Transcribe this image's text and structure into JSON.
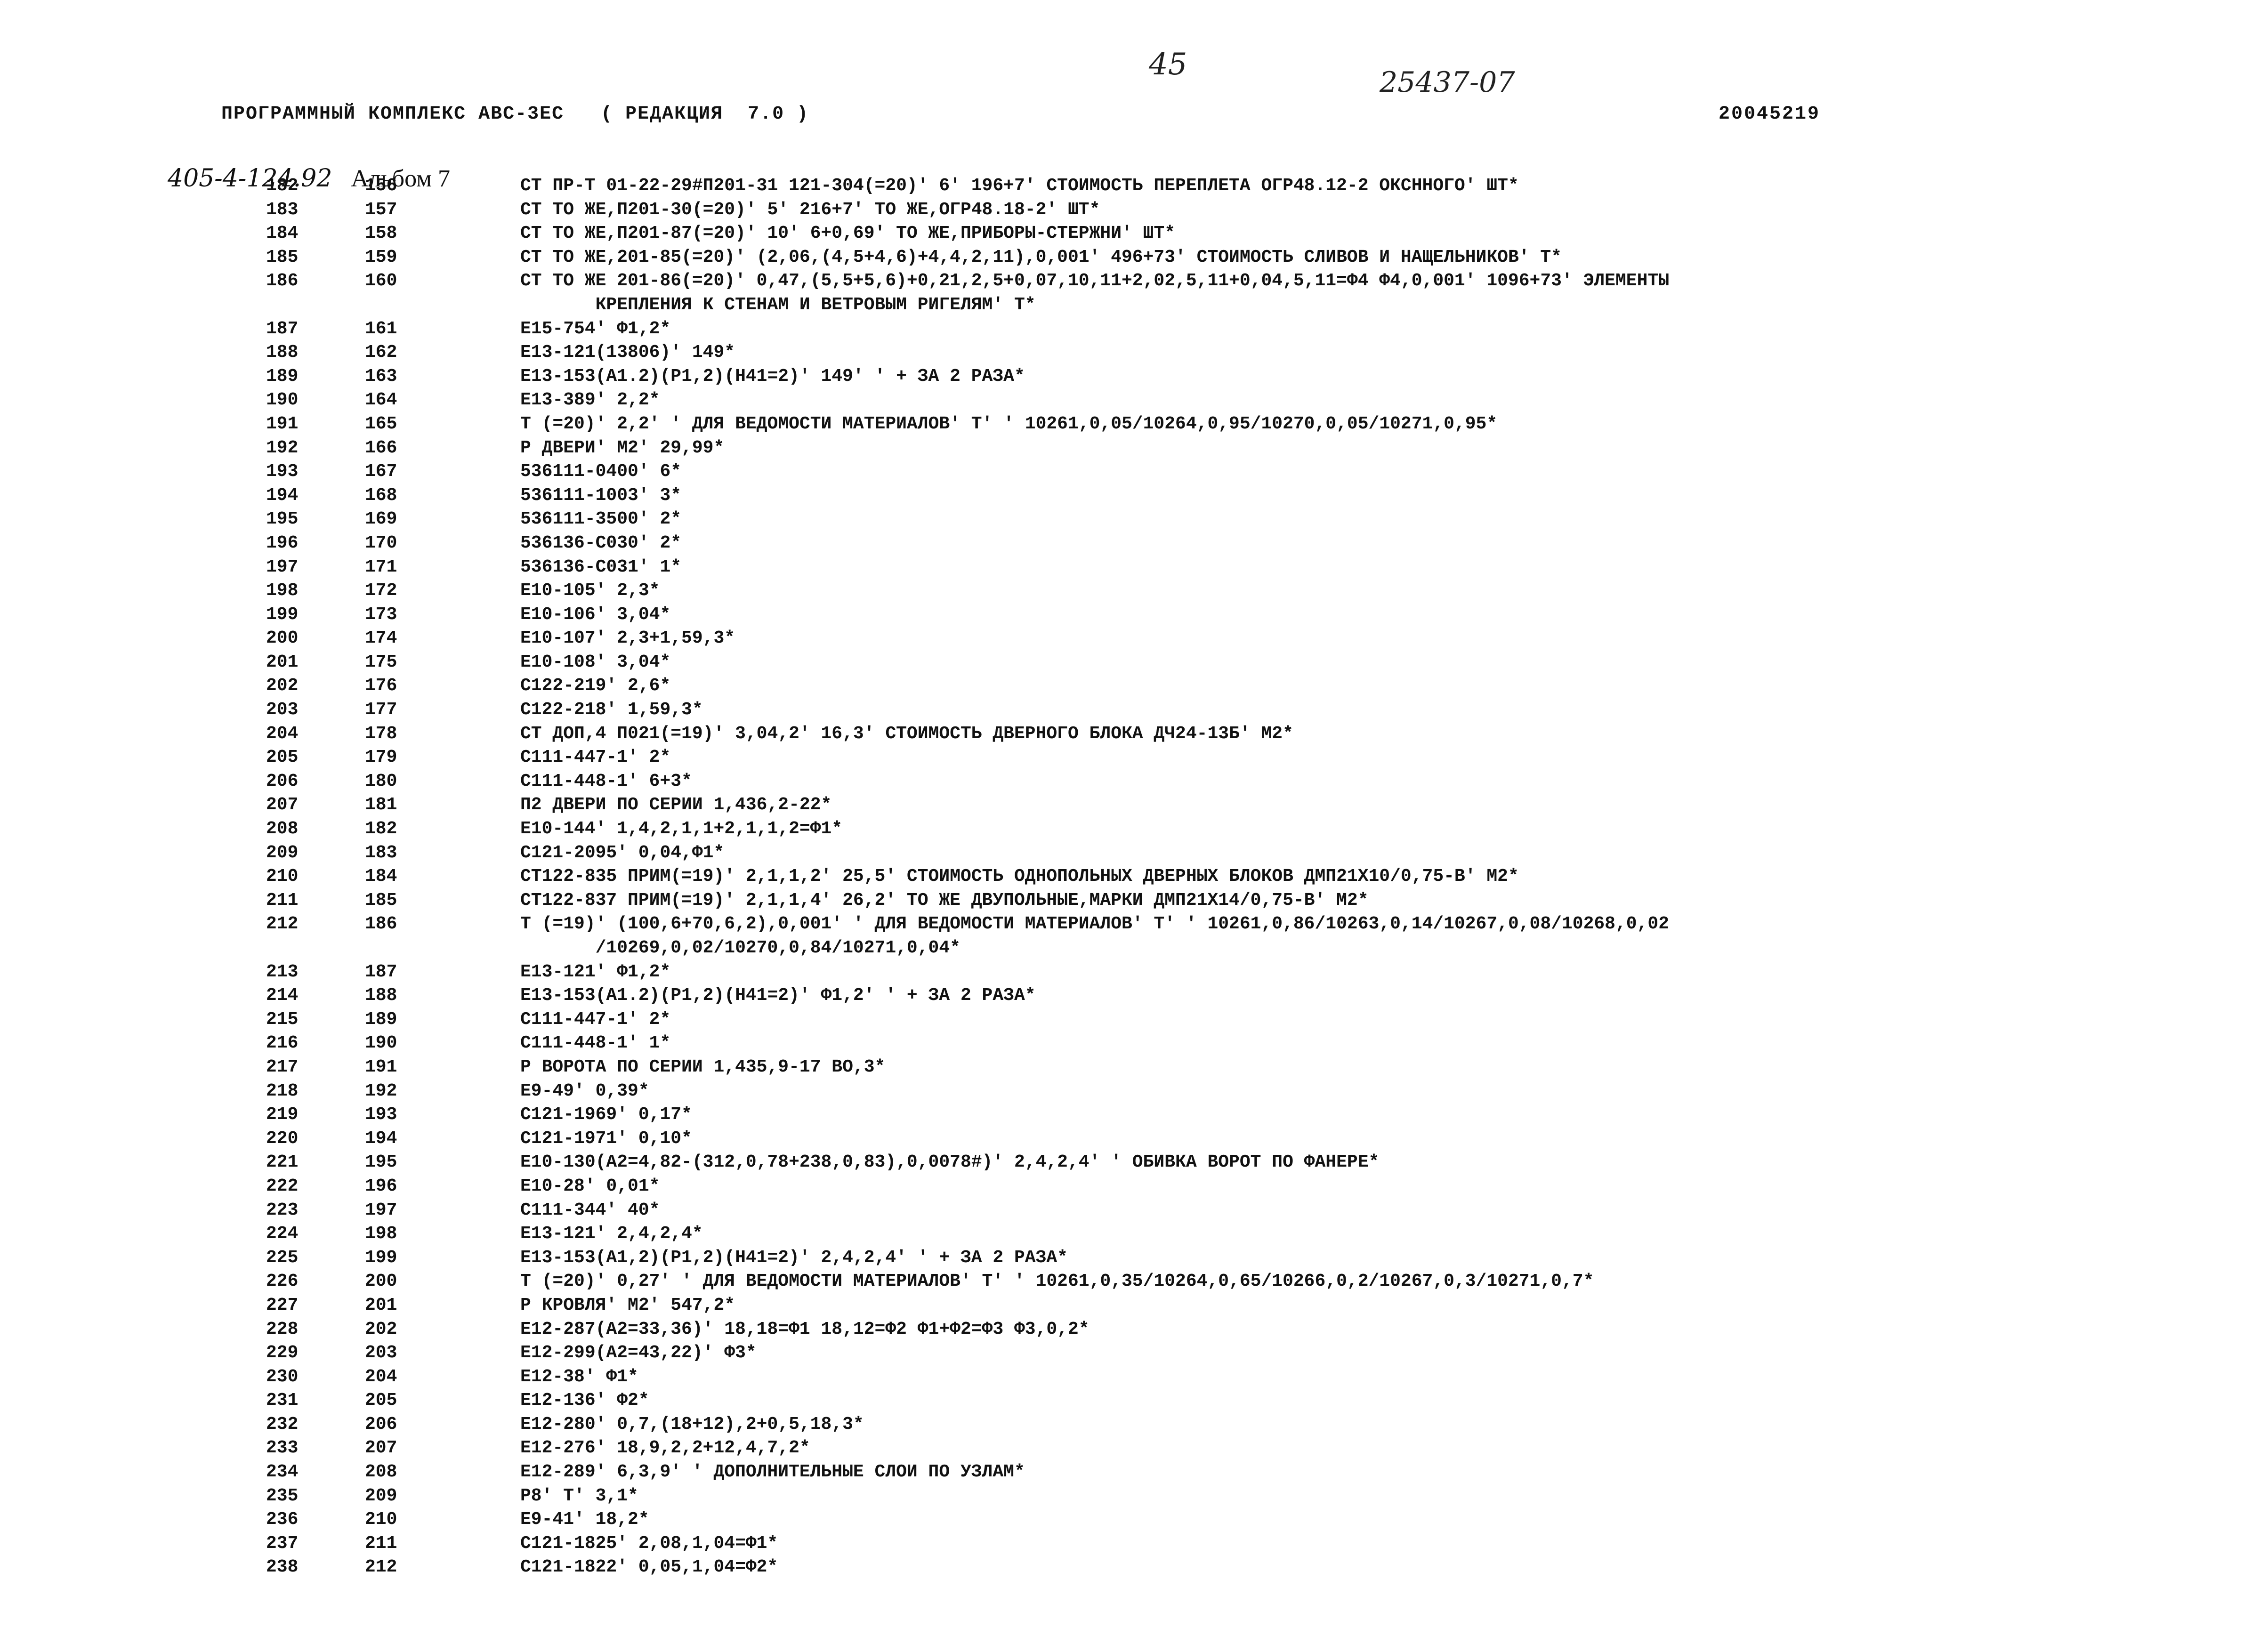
{
  "page_number": "45",
  "document_code": "25437-07",
  "header": {
    "title": "ПРОГРАММНЫЙ КОМПЛЕКС АВС-3ЕС   ( РЕДАКЦИЯ  7.0 )",
    "id": "20045219"
  },
  "album": {
    "code": "405-4-124.92",
    "label": "Альбом 7"
  },
  "rows": [
    {
      "n1": "182",
      "n2": "156",
      "text": "СТ ПР-Т 01-22-29#П201-31 121-304(=20)' 6' 196+7' СТОИМОСТЬ ПЕРЕПЛЕТА ОГР48.12-2 ОКСННОГО' ШТ*"
    },
    {
      "n1": "183",
      "n2": "157",
      "text": "СТ ТО ЖЕ,П201-30(=20)' 5' 216+7' ТО ЖЕ,ОГР48.18-2' ШТ*"
    },
    {
      "n1": "184",
      "n2": "158",
      "text": "СТ ТО ЖЕ,П201-87(=20)' 10' 6+0,69' ТО ЖЕ,ПРИБОРЫ-СТЕРЖНИ' ШТ*"
    },
    {
      "n1": "185",
      "n2": "159",
      "text": "СТ ТО ЖЕ,201-85(=20)' (2,06,(4,5+4,6)+4,4,2,11),0,001' 496+73' СТОИМОСТЬ СЛИВОВ И НАЩЕЛЬНИКОВ' Т*"
    },
    {
      "n1": "186",
      "n2": "160",
      "text": "СТ ТО ЖЕ 201-86(=20)' 0,47,(5,5+5,6)+0,21,2,5+0,07,10,11+2,02,5,11+0,04,5,11=Ф4 Ф4,0,001' 1096+73' ЭЛЕМЕНТЫ"
    },
    {
      "n1": "",
      "n2": "",
      "text": "       КРЕПЛЕНИЯ К СТЕНАМ И ВЕТРОВЫМ РИГЕЛЯМ' Т*",
      "cont": true
    },
    {
      "n1": "187",
      "n2": "161",
      "text": "Е15-754' Ф1,2*"
    },
    {
      "n1": "188",
      "n2": "162",
      "text": "Е13-121(13806)' 149*"
    },
    {
      "n1": "189",
      "n2": "163",
      "text": "Е13-153(А1.2)(Р1,2)(Н41=2)' 149' ' + ЗА 2 РАЗА*"
    },
    {
      "n1": "190",
      "n2": "164",
      "text": "Е13-389' 2,2*"
    },
    {
      "n1": "191",
      "n2": "165",
      "text": "Т (=20)' 2,2' ' ДЛЯ ВЕДОМОСТИ МАТЕРИАЛОВ' Т' ' 10261,0,05/10264,0,95/10270,0,05/10271,0,95*"
    },
    {
      "n1": "192",
      "n2": "166",
      "text": "Р ДВЕРИ' М2' 29,99*"
    },
    {
      "n1": "193",
      "n2": "167",
      "text": "536111-0400' 6*"
    },
    {
      "n1": "194",
      "n2": "168",
      "text": "536111-1003' 3*"
    },
    {
      "n1": "195",
      "n2": "169",
      "text": "536111-3500' 2*"
    },
    {
      "n1": "196",
      "n2": "170",
      "text": "536136-С030' 2*"
    },
    {
      "n1": "197",
      "n2": "171",
      "text": "536136-С031' 1*"
    },
    {
      "n1": "198",
      "n2": "172",
      "text": "Е10-105' 2,3*"
    },
    {
      "n1": "199",
      "n2": "173",
      "text": "Е10-106' 3,04*"
    },
    {
      "n1": "200",
      "n2": "174",
      "text": "Е10-107' 2,3+1,59,3*"
    },
    {
      "n1": "201",
      "n2": "175",
      "text": "Е10-108' 3,04*"
    },
    {
      "n1": "202",
      "n2": "176",
      "text": "С122-219' 2,6*"
    },
    {
      "n1": "203",
      "n2": "177",
      "text": "С122-218' 1,59,3*"
    },
    {
      "n1": "204",
      "n2": "178",
      "text": "СТ ДОП,4 П021(=19)' 3,04,2' 16,3' СТОИМОСТЬ ДВЕРНОГО БЛОКА ДЧ24-13Б' М2*"
    },
    {
      "n1": "205",
      "n2": "179",
      "text": "С111-447-1' 2*"
    },
    {
      "n1": "206",
      "n2": "180",
      "text": "С111-448-1' 6+3*"
    },
    {
      "n1": "207",
      "n2": "181",
      "text": "П2 ДВЕРИ ПО СЕРИИ 1,436,2-22*"
    },
    {
      "n1": "208",
      "n2": "182",
      "text": "Е10-144' 1,4,2,1,1+2,1,1,2=Ф1*"
    },
    {
      "n1": "209",
      "n2": "183",
      "text": "С121-2095' 0,04,Ф1*"
    },
    {
      "n1": "210",
      "n2": "184",
      "text": "СТ122-835 ПРИМ(=19)' 2,1,1,2' 25,5' СТОИМОСТЬ ОДНОПОЛЬНЫХ ДВЕРНЫХ БЛОКОВ ДМП21Х10/0,75-В' М2*"
    },
    {
      "n1": "211",
      "n2": "185",
      "text": "СТ122-837 ПРИМ(=19)' 2,1,1,4' 26,2' ТО ЖЕ ДВУПОЛЬНЫЕ,МАРКИ ДМП21Х14/0,75-В' М2*"
    },
    {
      "n1": "212",
      "n2": "186",
      "text": "Т (=19)' (100,6+70,6,2),0,001' ' ДЛЯ ВЕДОМОСТИ МАТЕРИАЛОВ' Т' ' 10261,0,86/10263,0,14/10267,0,08/10268,0,02"
    },
    {
      "n1": "",
      "n2": "",
      "text": "       /10269,0,02/10270,0,84/10271,0,04*",
      "cont": true
    },
    {
      "n1": "213",
      "n2": "187",
      "text": "Е13-121' Ф1,2*"
    },
    {
      "n1": "214",
      "n2": "188",
      "text": "Е13-153(А1.2)(Р1,2)(Н41=2)' Ф1,2' ' + ЗА 2 РАЗА*"
    },
    {
      "n1": "215",
      "n2": "189",
      "text": "С111-447-1' 2*"
    },
    {
      "n1": "216",
      "n2": "190",
      "text": "С111-448-1' 1*"
    },
    {
      "n1": "217",
      "n2": "191",
      "text": "Р ВОРОТА ПО СЕРИИ 1,435,9-17 ВО,3*"
    },
    {
      "n1": "218",
      "n2": "192",
      "text": "Е9-49' 0,39*"
    },
    {
      "n1": "219",
      "n2": "193",
      "text": "С121-1969' 0,17*"
    },
    {
      "n1": "220",
      "n2": "194",
      "text": "С121-1971' 0,10*"
    },
    {
      "n1": "221",
      "n2": "195",
      "text": "Е10-130(А2=4,82-(312,0,78+238,0,83),0,0078#)' 2,4,2,4' ' ОБИВКА ВОРОТ ПО ФАНЕРЕ*"
    },
    {
      "n1": "222",
      "n2": "196",
      "text": "Е10-28' 0,01*"
    },
    {
      "n1": "223",
      "n2": "197",
      "text": "С111-344' 40*"
    },
    {
      "n1": "224",
      "n2": "198",
      "text": "Е13-121' 2,4,2,4*"
    },
    {
      "n1": "225",
      "n2": "199",
      "text": "Е13-153(А1,2)(Р1,2)(Н41=2)' 2,4,2,4' ' + ЗА 2 РАЗА*"
    },
    {
      "n1": "226",
      "n2": "200",
      "text": "Т (=20)' 0,27' ' ДЛЯ ВЕДОМОСТИ МАТЕРИАЛОВ' Т' ' 10261,0,35/10264,0,65/10266,0,2/10267,0,3/10271,0,7*"
    },
    {
      "n1": "227",
      "n2": "201",
      "text": "Р КРОВЛЯ' М2' 547,2*"
    },
    {
      "n1": "228",
      "n2": "202",
      "text": "Е12-287(А2=33,36)' 18,18=Ф1 18,12=Ф2 Ф1+Ф2=Ф3 Ф3,0,2*"
    },
    {
      "n1": "229",
      "n2": "203",
      "text": "Е12-299(А2=43,22)' Ф3*"
    },
    {
      "n1": "230",
      "n2": "204",
      "text": "Е12-38' Ф1*"
    },
    {
      "n1": "231",
      "n2": "205",
      "text": "Е12-136' Ф2*"
    },
    {
      "n1": "232",
      "n2": "206",
      "text": "Е12-280' 0,7,(18+12),2+0,5,18,3*"
    },
    {
      "n1": "233",
      "n2": "207",
      "text": "Е12-276' 18,9,2,2+12,4,7,2*"
    },
    {
      "n1": "234",
      "n2": "208",
      "text": "Е12-289' 6,3,9' ' ДОПОЛНИТЕЛЬНЫЕ СЛОИ ПО УЗЛАМ*"
    },
    {
      "n1": "235",
      "n2": "209",
      "text": "Р8' Т' 3,1*"
    },
    {
      "n1": "236",
      "n2": "210",
      "text": "Е9-41' 18,2*"
    },
    {
      "n1": "237",
      "n2": "211",
      "text": "С121-1825' 2,08,1,04=Ф1*"
    },
    {
      "n1": "238",
      "n2": "212",
      "text": "С121-1822' 0,05,1,04=Ф2*"
    }
  ]
}
